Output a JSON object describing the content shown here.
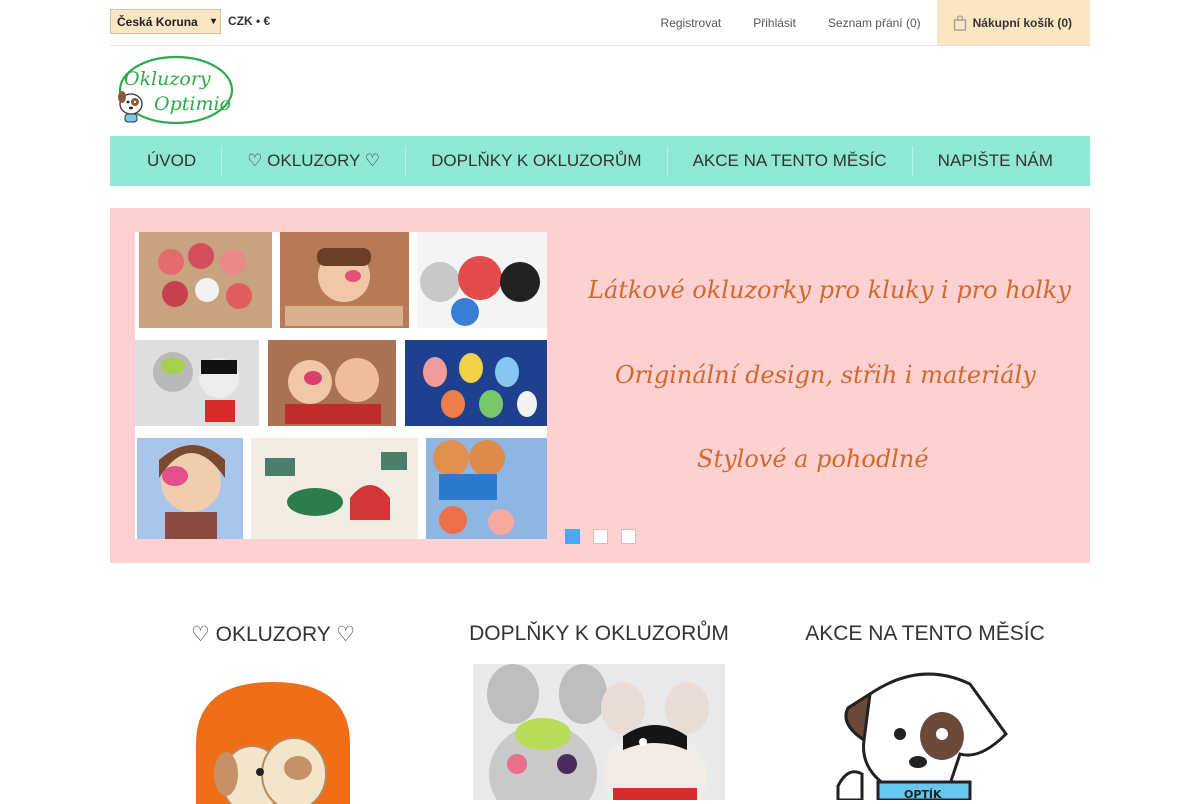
{
  "topbar": {
    "currency_selected": "Česká Koruna",
    "currency_note": "CZK • €",
    "links": {
      "register": "Registrovat",
      "login": "Přihlásit",
      "wishlist": "Seznam přání (0)"
    },
    "cart_label": "Nákupní košík (0)"
  },
  "logo": {
    "line1": "Okluzory",
    "line2": "Optimio"
  },
  "menu": {
    "items": [
      "ÚVOD",
      "♡ OKLUZORY ♡",
      "DOPLŇKY K OKLUZORŮM",
      "AKCE NA TENTO MĚSÍC",
      "NAPIŠTE NÁM"
    ]
  },
  "slider": {
    "lines": [
      "Látkové okluzorky pro kluky i pro holky",
      "Originální design, střih i materiály",
      "Stylové a pohodlné"
    ],
    "dots": 3,
    "active_dot": 1
  },
  "categories": [
    {
      "title": "♡ OKLUZORY ♡"
    },
    {
      "title": "DOPLŇKY K OKLUZORŮM"
    },
    {
      "title": "AKCE NA TENTO MĚSÍC"
    }
  ],
  "colors": {
    "menu_bg": "#8ee8d5",
    "slider_bg": "#fdd1d1",
    "cart_bg": "#fbe6c4",
    "slide_text": "#d2692c",
    "dot_active": "#4ca8ee"
  }
}
